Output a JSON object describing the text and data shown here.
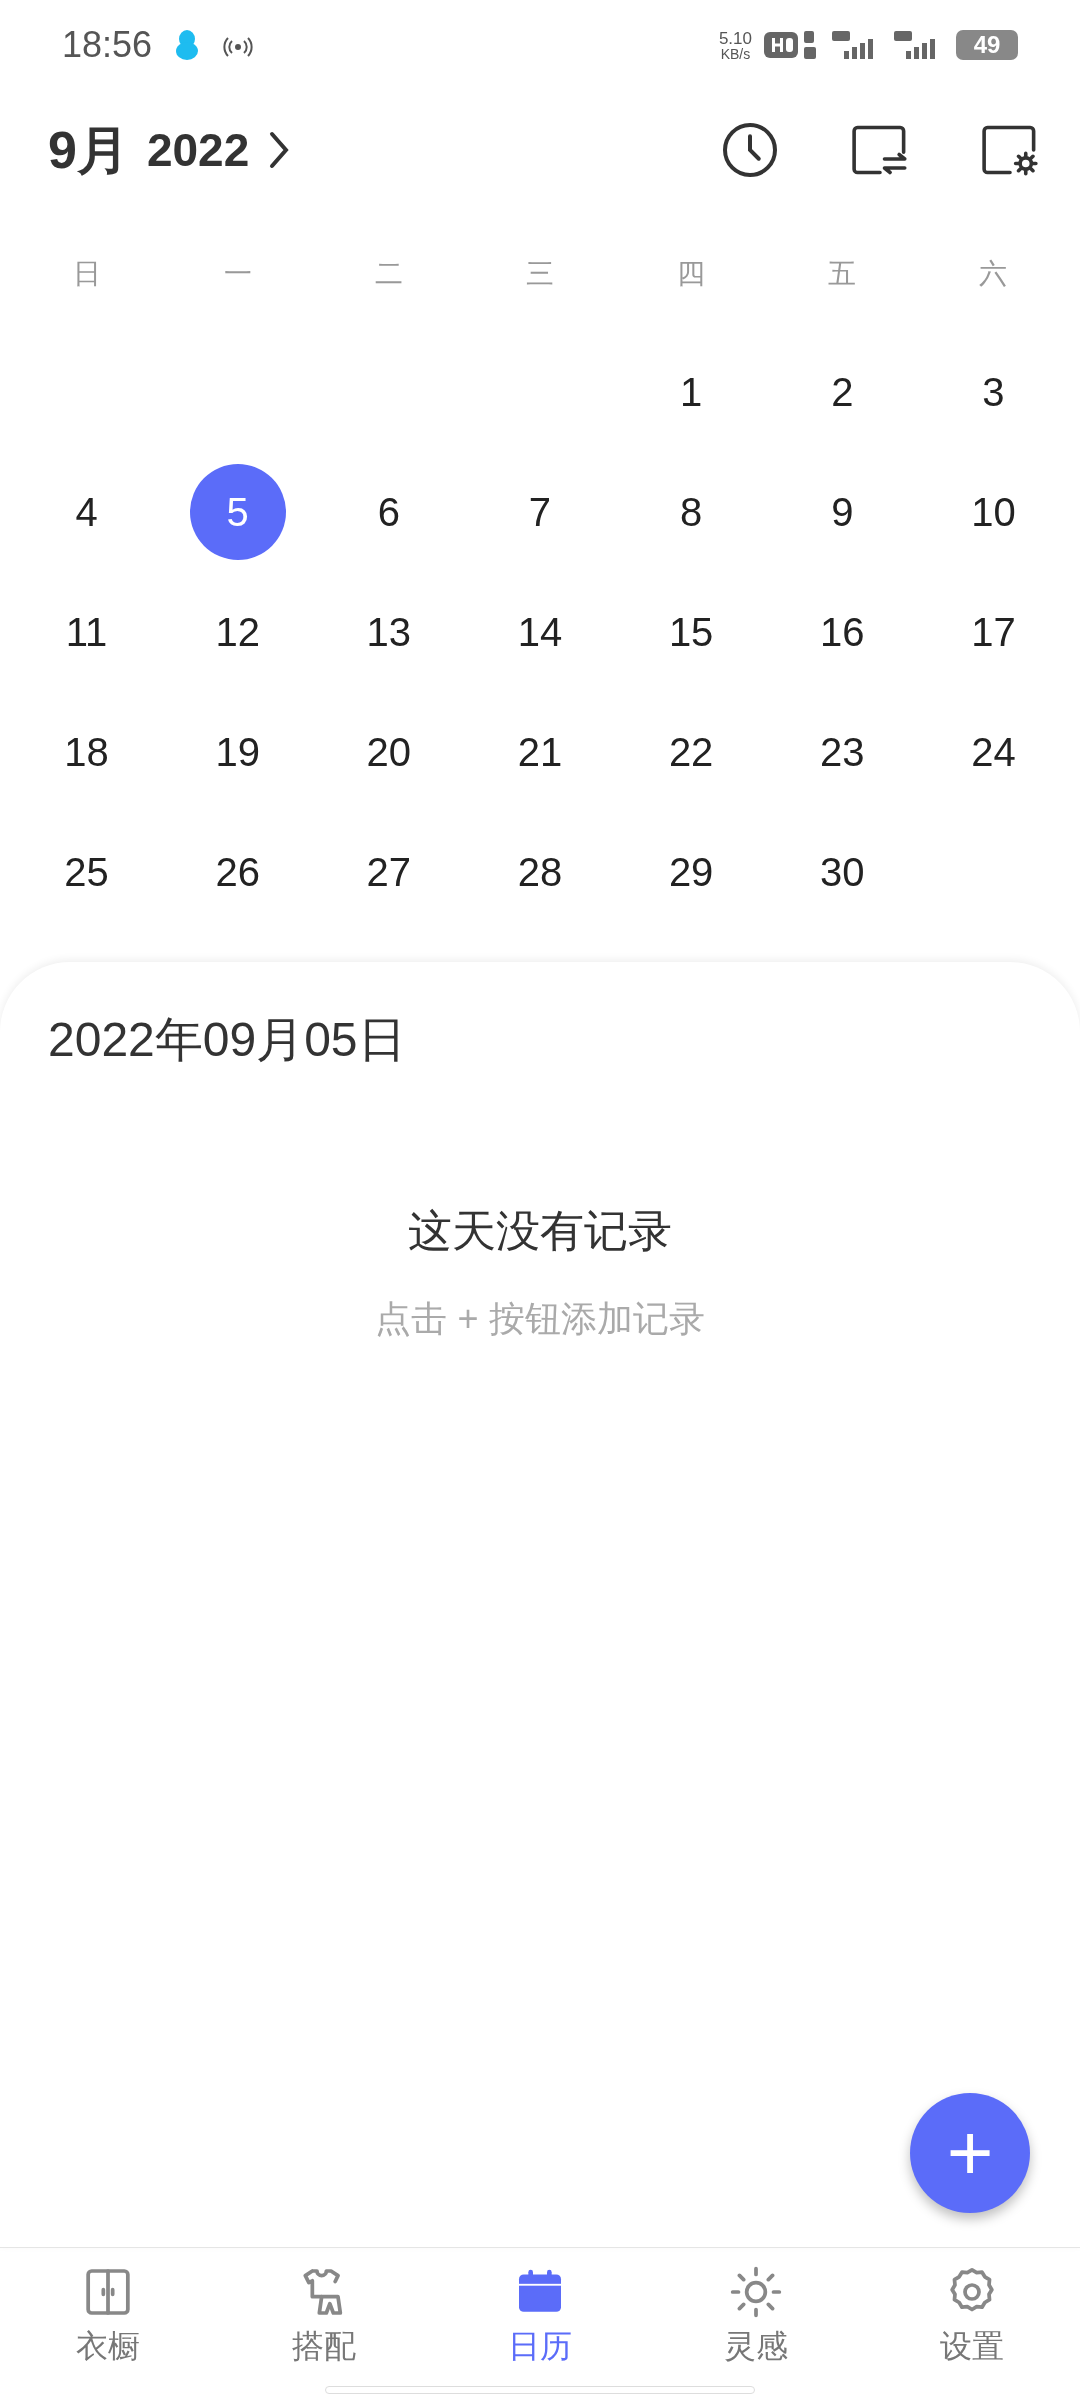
{
  "status_bar": {
    "time": "18:56",
    "speed": "5.10",
    "speed_unit": "KB/s",
    "battery": "49"
  },
  "header": {
    "month": "9月",
    "year": "2022"
  },
  "weekdays": [
    "日",
    "一",
    "二",
    "三",
    "四",
    "五",
    "六"
  ],
  "weeks": [
    {
      "right_aligned": true,
      "days": [
        {
          "label": "1",
          "selected": false
        },
        {
          "label": "2",
          "selected": false
        },
        {
          "label": "3",
          "selected": false
        }
      ]
    },
    {
      "days": [
        {
          "label": "4",
          "selected": false
        },
        {
          "label": "5",
          "selected": true
        },
        {
          "label": "6",
          "selected": false
        },
        {
          "label": "7",
          "selected": false
        },
        {
          "label": "8",
          "selected": false
        },
        {
          "label": "9",
          "selected": false
        },
        {
          "label": "10",
          "selected": false
        }
      ]
    },
    {
      "days": [
        {
          "label": "11",
          "selected": false
        },
        {
          "label": "12",
          "selected": false
        },
        {
          "label": "13",
          "selected": false
        },
        {
          "label": "14",
          "selected": false
        },
        {
          "label": "15",
          "selected": false
        },
        {
          "label": "16",
          "selected": false
        },
        {
          "label": "17",
          "selected": false
        }
      ]
    },
    {
      "days": [
        {
          "label": "18",
          "selected": false
        },
        {
          "label": "19",
          "selected": false
        },
        {
          "label": "20",
          "selected": false
        },
        {
          "label": "21",
          "selected": false
        },
        {
          "label": "22",
          "selected": false
        },
        {
          "label": "23",
          "selected": false
        },
        {
          "label": "24",
          "selected": false
        }
      ]
    },
    {
      "right_aligned": false,
      "days": [
        {
          "label": "25",
          "selected": false
        },
        {
          "label": "26",
          "selected": false
        },
        {
          "label": "27",
          "selected": false
        },
        {
          "label": "28",
          "selected": false
        },
        {
          "label": "29",
          "selected": false
        },
        {
          "label": "30",
          "selected": false
        }
      ]
    }
  ],
  "detail": {
    "date": "2022年09月05日",
    "empty_title": "这天没有记录",
    "empty_hint": "点击 + 按钮添加记录"
  },
  "fab": {
    "label": "+"
  },
  "nav": [
    {
      "kind": "wardrobe",
      "label": "衣橱",
      "selected": false
    },
    {
      "kind": "outfit",
      "label": "搭配",
      "selected": false
    },
    {
      "kind": "calendar",
      "label": "日历",
      "selected": true
    },
    {
      "kind": "sun",
      "label": "灵感",
      "selected": false
    },
    {
      "kind": "gear",
      "label": "设置",
      "selected": false
    }
  ]
}
